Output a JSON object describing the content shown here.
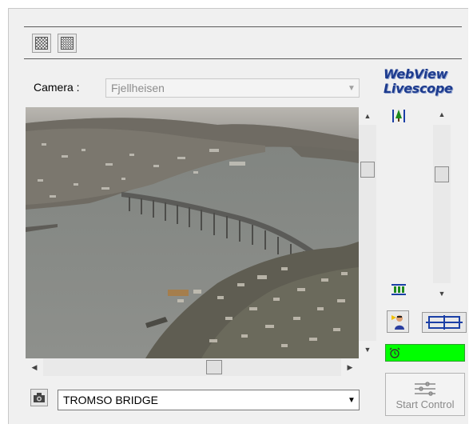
{
  "toolbar": {
    "buttons": [
      {
        "icon": "pattern-grid-icon"
      },
      {
        "icon": "pattern-hatch-icon"
      }
    ]
  },
  "camera": {
    "label": "Camera :",
    "selected": "Fjellheisen",
    "enabled": false
  },
  "logo": {
    "line1": "WebView",
    "line2": "Livescope",
    "color": "#1d3b8e"
  },
  "video": {
    "description_icon": "live-camera-feed",
    "horizontal_scroll_position": 0.5,
    "vertical_scroll_position": 0.25
  },
  "zoom": {
    "tele_icon": "zoom-tele-tree-icon",
    "wide_icon": "zoom-wide-trees-icon",
    "level": 0.35
  },
  "controls": {
    "person_icon": "person-camera-icon",
    "frame_icon": "frame-resize-icon"
  },
  "status": {
    "icon": "alarm-clock-icon",
    "color": "#00ff00"
  },
  "start_control": {
    "label": "Start Control",
    "enabled": false
  },
  "preset": {
    "selected": "TROMSO BRIDGE"
  }
}
